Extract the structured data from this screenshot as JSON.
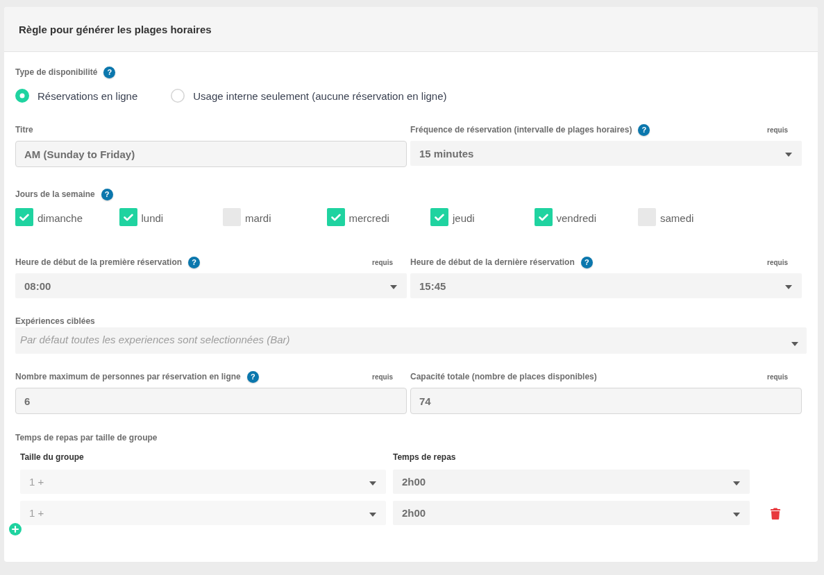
{
  "panel": {
    "title": "Règle pour générer les plages horaires"
  },
  "sections": [
    {
      "kind": "radio-group",
      "label": "Type de disponibilité",
      "help": "?",
      "options": [
        {
          "label": "Réservations en ligne",
          "selected": true
        },
        {
          "label": "Usage interne seulement (aucune réservation en ligne)",
          "selected": false
        }
      ]
    },
    {
      "kind": "field-row",
      "fields": [
        {
          "kind": "text",
          "label": "Titre",
          "value": "AM (Sunday to Friday)"
        },
        {
          "kind": "select",
          "label": "Fréquence de réservation (intervalle de plages horaires)",
          "help": "?",
          "required": "requis",
          "value": "15 minutes"
        }
      ]
    },
    {
      "kind": "checkbox-group",
      "label": "Jours de la semaine",
      "help": "?",
      "options": [
        {
          "label": "dimanche",
          "checked": true
        },
        {
          "label": "lundi",
          "checked": true
        },
        {
          "label": "mardi",
          "checked": false
        },
        {
          "label": "mercredi",
          "checked": true
        },
        {
          "label": "jeudi",
          "checked": true
        },
        {
          "label": "vendredi",
          "checked": true
        },
        {
          "label": "samedi",
          "checked": false
        }
      ]
    },
    {
      "kind": "field-row",
      "fields": [
        {
          "kind": "select",
          "label": "Heure de début de la première réservation",
          "help": "?",
          "required": "requis",
          "value": "08:00"
        },
        {
          "kind": "select",
          "label": "Heure de début de la dernière réservation",
          "help": "?",
          "required": "requis",
          "value": "15:45"
        }
      ]
    },
    {
      "kind": "field-row",
      "fields": [
        {
          "kind": "select",
          "label": "Expériences ciblées",
          "placeholder": "Par défaut toutes les experiences sont selectionnées (Bar)"
        }
      ]
    },
    {
      "kind": "field-row",
      "fields": [
        {
          "kind": "text",
          "label": "Nombre maximum de personnes par réservation en ligne",
          "help": "?",
          "required": "requis",
          "value": "6"
        },
        {
          "kind": "text",
          "label": "Capacité totale (nombre de places disponibles)",
          "required": "requis",
          "value": "74"
        }
      ]
    },
    {
      "kind": "table",
      "label": "Temps de repas par taille de groupe",
      "columns": [
        "Taille du groupe",
        "Temps de repas"
      ],
      "rows": [
        {
          "group_size": {
            "value": "1 +",
            "disabled": true
          },
          "meal_time": {
            "value": "2h00",
            "disabled": false
          },
          "deletable": false
        },
        {
          "group_size": {
            "value": "1 +",
            "disabled": true
          },
          "meal_time": {
            "value": "2h00",
            "disabled": false
          },
          "deletable": true
        }
      ]
    }
  ]
}
